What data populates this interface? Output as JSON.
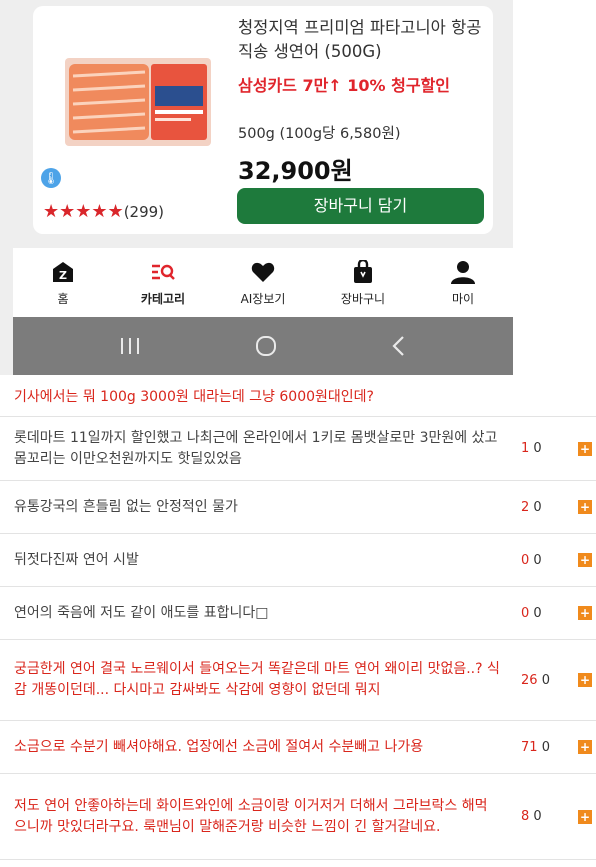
{
  "product": {
    "name": "청정지역 프리미엄 파타고니아 항공직송 생연어 (500G)",
    "promo": "삼성카드 7만↑ 10% 청구할인",
    "weight": "500g (100g당 6,580원)",
    "price": "32,900원",
    "rating_stars": "★★★★★",
    "rating_count": "(299)",
    "cart_button": "장바구니 담기"
  },
  "nav": {
    "items": [
      {
        "label": "홈",
        "icon": "home-icon"
      },
      {
        "label": "카테고리",
        "icon": "category-icon"
      },
      {
        "label": "AI장보기",
        "icon": "heart-icon"
      },
      {
        "label": "장바구니",
        "icon": "bag-icon"
      },
      {
        "label": "마이",
        "icon": "person-icon"
      }
    ]
  },
  "system_bar": {
    "recent": "|||",
    "home": "○",
    "back": "<"
  },
  "colors": {
    "accent_red": "#d9261c",
    "cart_green": "#1e7a3c",
    "plus_orange": "#f08a1c"
  },
  "head_comment": "기사에서는 뭐 100g 3000원 대라는데 그냥 6000원대인데?",
  "comments": [
    {
      "text": "롯데마트 11일까지 할인했고 나최근에 온라인에서 1키로 몸뱃살로만 3만원에 샀고 몸꼬리는 이만오천원까지도 핫딜있었음",
      "up": "1",
      "down": "0",
      "red": false
    },
    {
      "text": "유통강국의 흔들림 없는 안정적인 물가",
      "up": "2",
      "down": "0",
      "red": false
    },
    {
      "text": "뒤젓다진짜 연어 시발",
      "up": "0",
      "down": "0",
      "red": false
    },
    {
      "text": "연어의 죽음에 저도 같이 애도를 표합니다□",
      "up": "0",
      "down": "0",
      "red": false
    },
    {
      "text": "궁금한게 연어 결국 노르웨이서 들여오는거 똑같은데 마트 연어 왜이리 맛없음..? 식감 개똥이던데... 다시마고 감싸봐도 삭감에 영향이 없던데 뭐지",
      "up": "26",
      "down": "0",
      "red": true
    },
    {
      "text": "소금으로 수분기 빼셔야해요. 업장에선 소금에 절여서 수분빼고 나가용",
      "up": "71",
      "down": "0",
      "red": true
    },
    {
      "text": "저도 연어 안좋아하는데 화이트와인에 소금이랑 이거저거 더해서 그라브락스 해먹으니까 맛있더라구요. 룩맨님이 말해준거랑 비슷한 느낌이 긴 할거갈네요.",
      "up": "8",
      "down": "0",
      "red": true
    }
  ]
}
